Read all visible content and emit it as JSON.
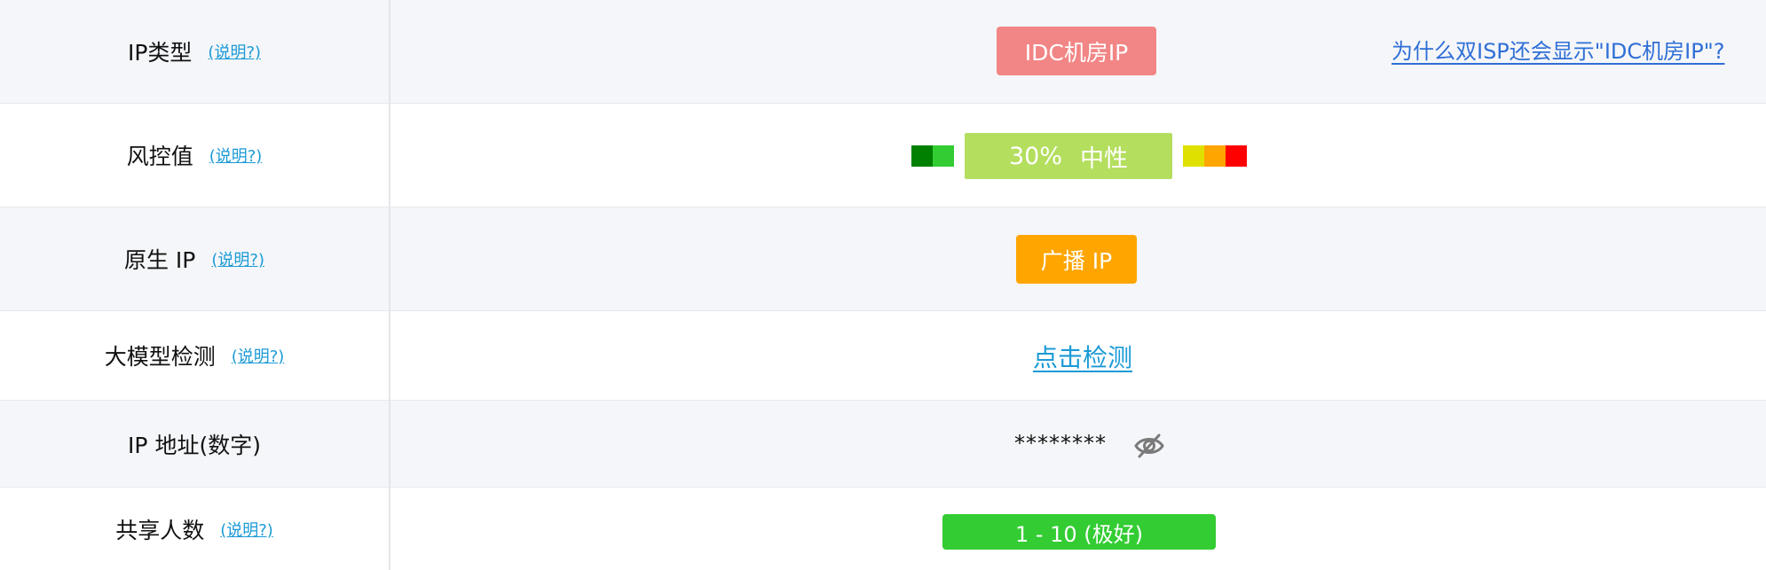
{
  "rows": [
    {
      "label": "IP类型",
      "explain": "(说明?)",
      "badge": "IDC机房IP",
      "badge_color": "#f28585",
      "side_link": "为什么双ISP还会显示\"IDC机房IP\"?"
    },
    {
      "label": "风控值",
      "explain": "(说明?)",
      "score": "30%",
      "level": "中性",
      "score_fraction": 0.3,
      "badge_color": "#b4de5e",
      "scale_colors": [
        "#008000",
        "#33cc33",
        "#e0e000",
        "#ffa500",
        "#ff0000"
      ]
    },
    {
      "label": "原生 IP",
      "explain": "(说明?)",
      "badge": "广播 IP",
      "badge_color": "#ffa500"
    },
    {
      "label": "大模型检测",
      "explain": "(说明?)",
      "link": "点击检测"
    },
    {
      "label": "IP 地址(数字)",
      "value": "********",
      "icon": "eye-slash-icon"
    },
    {
      "label": "共享人数",
      "explain": "(说明?)",
      "badge": "1 - 10 (极好)",
      "badge_color": "#33cc33"
    }
  ]
}
